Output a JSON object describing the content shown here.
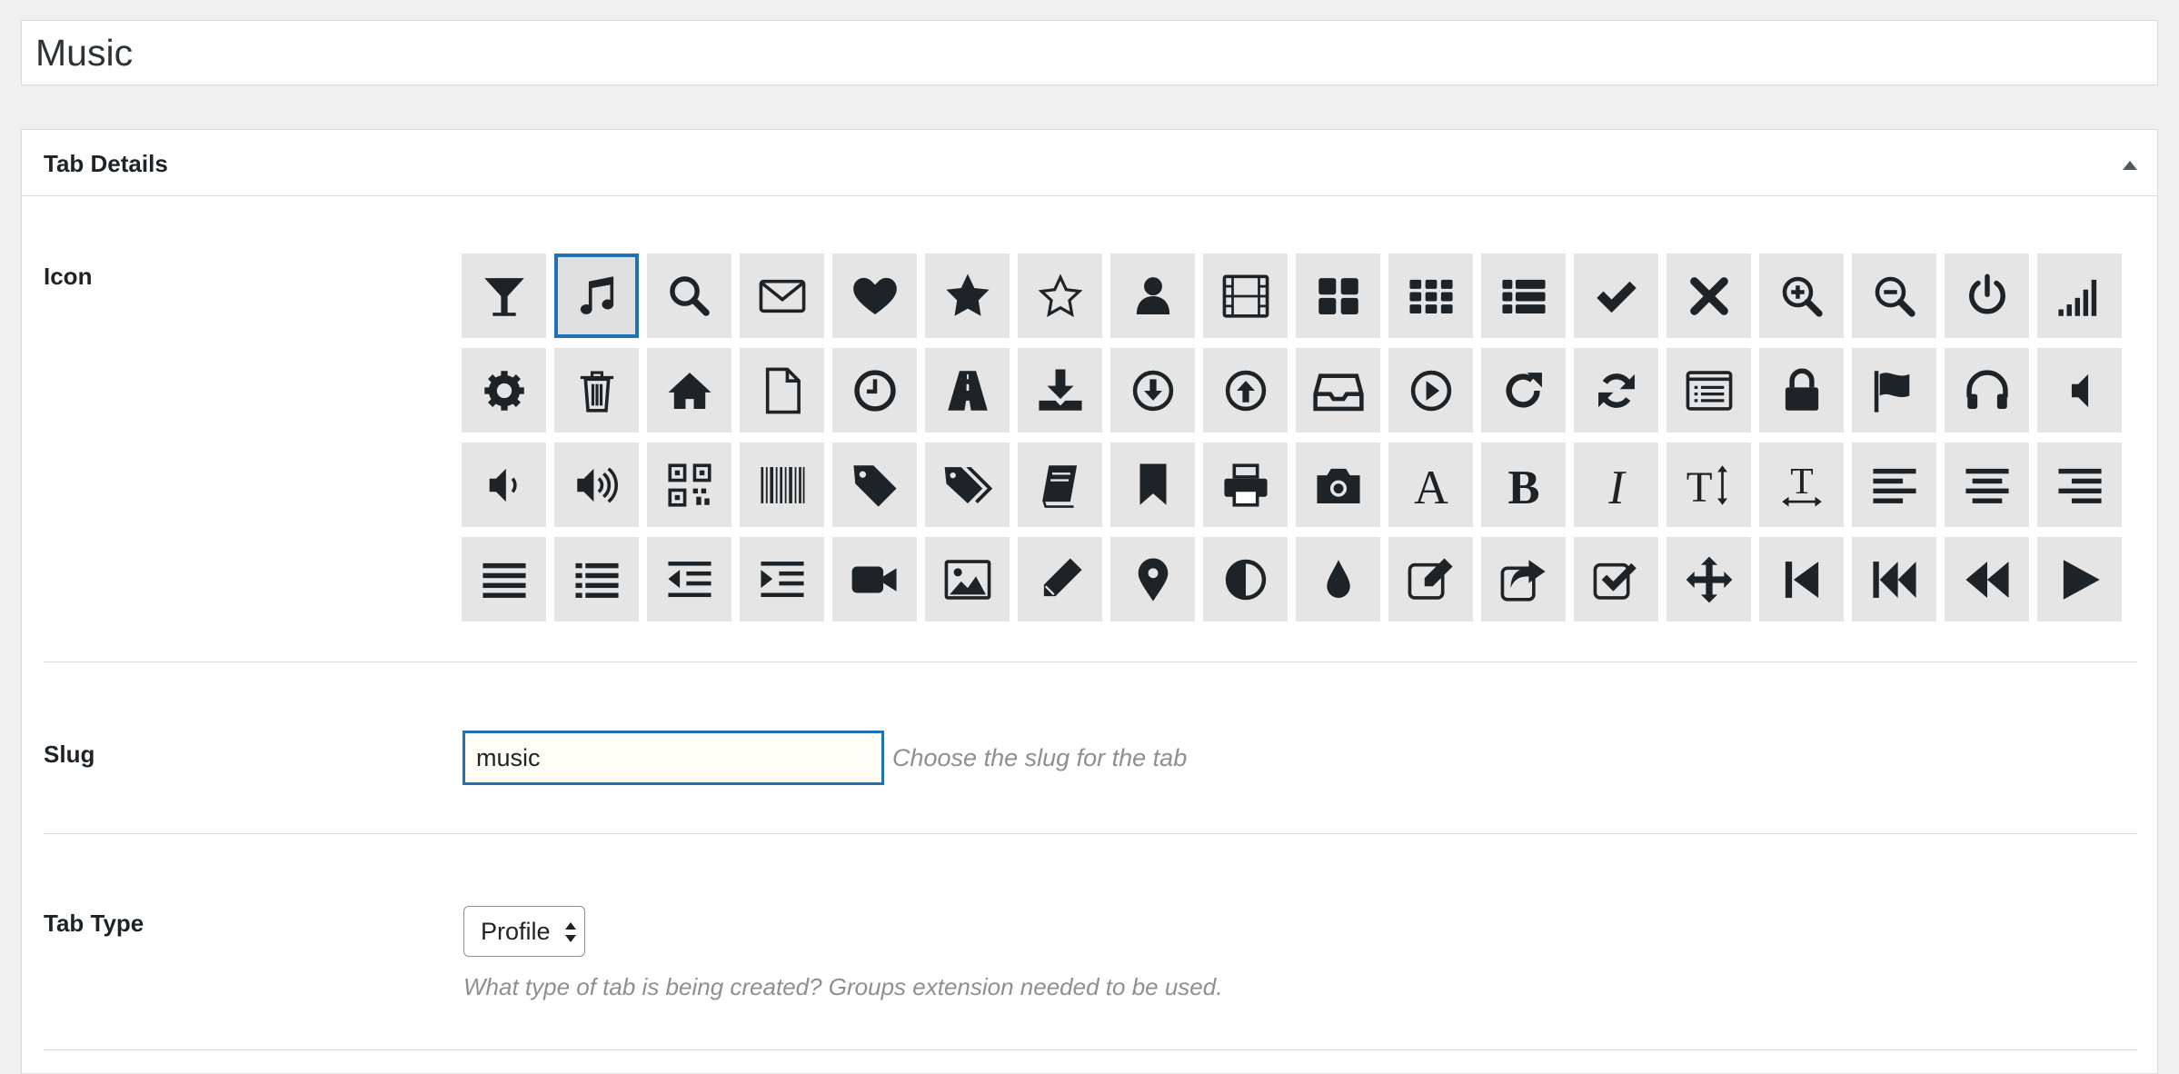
{
  "title": {
    "value": "Music"
  },
  "panel": {
    "title": "Tab Details"
  },
  "icon": {
    "label": "Icon",
    "selected": "music",
    "items": [
      "glass",
      "music",
      "search",
      "envelope",
      "heart",
      "star",
      "star-empty",
      "user",
      "film",
      "th-large",
      "th",
      "th-list",
      "ok",
      "remove",
      "zoom-in",
      "zoom-out",
      "off",
      "signal",
      "cog",
      "trash",
      "home",
      "file",
      "time",
      "road",
      "download-alt",
      "download",
      "upload",
      "inbox",
      "play-circle",
      "repeat",
      "refresh",
      "list-alt",
      "lock",
      "flag",
      "headphones",
      "volume-off",
      "volume-down",
      "volume-up",
      "qrcode",
      "barcode",
      "tag",
      "tags",
      "book",
      "bookmark",
      "print",
      "camera",
      "font",
      "bold",
      "italic",
      "text-height",
      "text-width",
      "align-left",
      "align-center",
      "align-right",
      "align-justify",
      "list",
      "indent-left",
      "indent-right",
      "facetime-video",
      "picture",
      "pencil",
      "map-marker",
      "adjust",
      "tint",
      "edit",
      "share",
      "check",
      "move",
      "step-backward",
      "fast-backward",
      "backward",
      "play"
    ]
  },
  "slug": {
    "label": "Slug",
    "value": "music",
    "help": "Choose the slug for the tab"
  },
  "tab_type": {
    "label": "Tab Type",
    "selected": "Profile",
    "help": "What type of tab is being created? Groups extension needed to be used."
  },
  "colors": {
    "accent": "#2271b1",
    "icon": "#1d2327",
    "cell": "#e5e5e5"
  }
}
